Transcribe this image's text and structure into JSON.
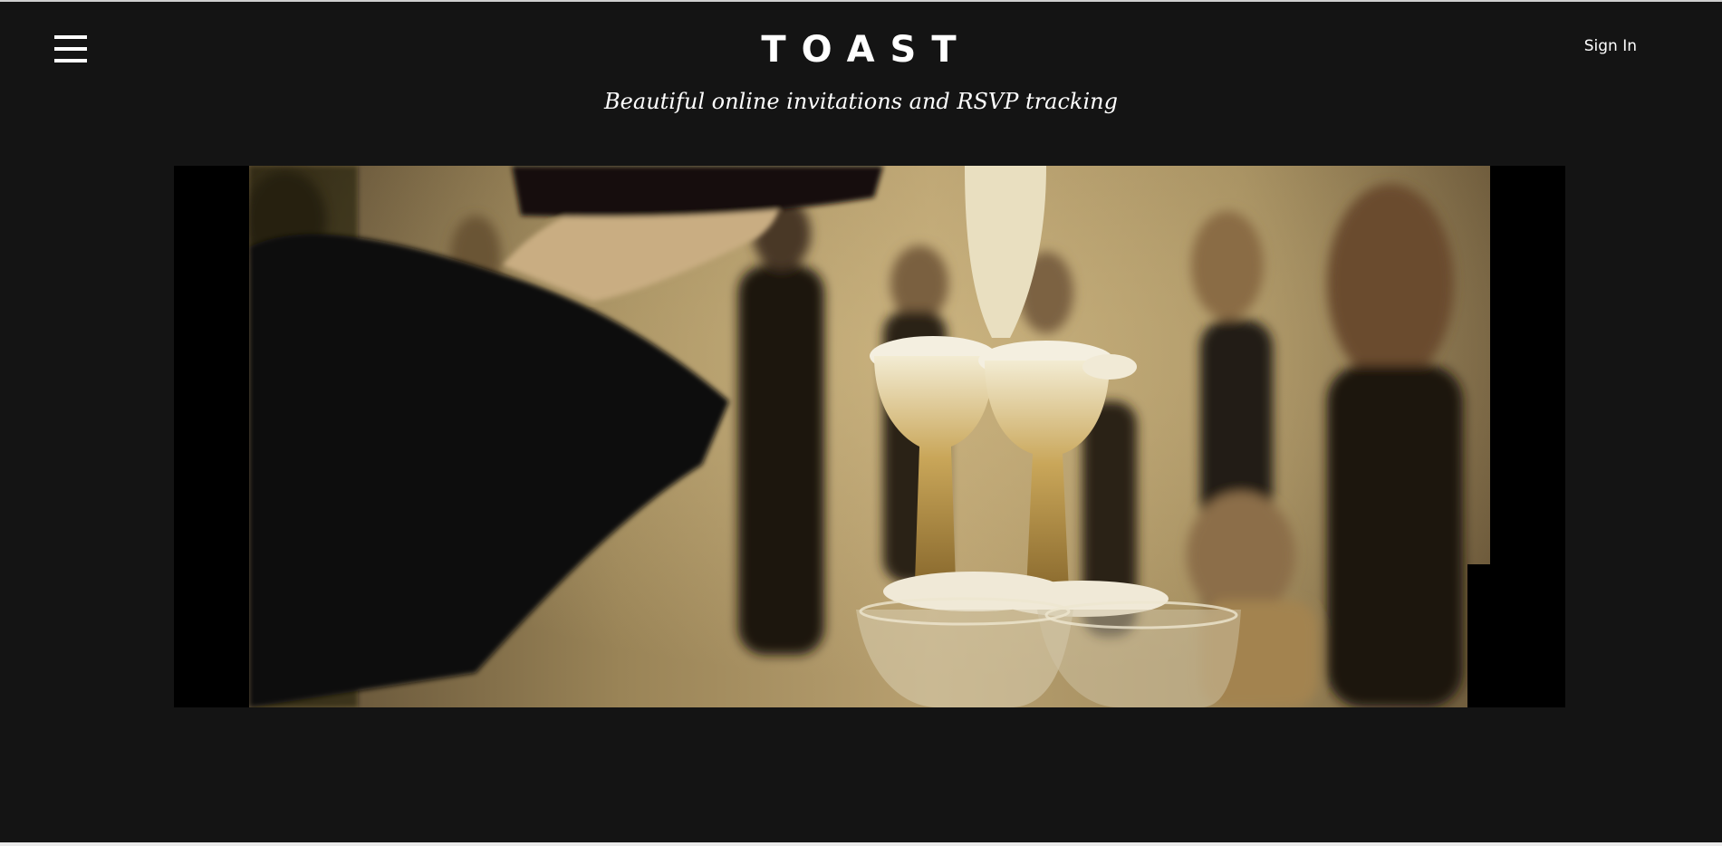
{
  "header": {
    "menu_icon": "hamburger-menu-icon",
    "logo": "TOAST",
    "tagline": "Beautiful online invitations and RSVP tracking",
    "sign_in_label": "Sign In"
  },
  "hero": {
    "media": "champagne-tower-video",
    "colors": {
      "page_background": "#141414",
      "letterbox": "#000000"
    }
  }
}
